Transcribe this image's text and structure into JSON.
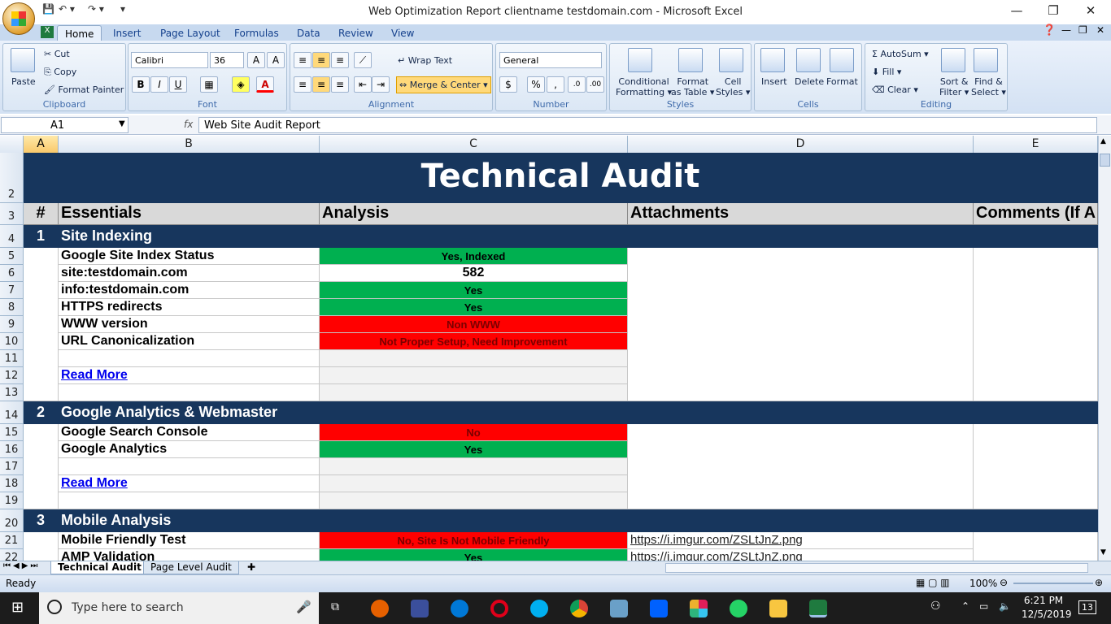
{
  "window": {
    "title": "Web Optimization Report clientname testdomain.com - Microsoft Excel"
  },
  "ribbon_tabs": [
    "Home",
    "Insert",
    "Page Layout",
    "Formulas",
    "Data",
    "Review",
    "View"
  ],
  "ribbon": {
    "clipboard": {
      "paste": "Paste",
      "cut": "Cut",
      "copy": "Copy",
      "format_painter": "Format Painter",
      "group": "Clipboard"
    },
    "font": {
      "name": "Calibri",
      "size": "36",
      "group": "Font"
    },
    "alignment": {
      "wrap": "Wrap Text",
      "merge": "Merge & Center",
      "group": "Alignment"
    },
    "number": {
      "format": "General",
      "group": "Number"
    },
    "styles": {
      "cond_line1": "Conditional",
      "cond_line2": "Formatting",
      "table_line1": "Format",
      "table_line2": "as Table",
      "cell_line1": "Cell",
      "cell_line2": "Styles",
      "group": "Styles"
    },
    "cells": {
      "insert": "Insert",
      "delete": "Delete",
      "format": "Format",
      "group": "Cells"
    },
    "editing": {
      "autosum": "AutoSum",
      "fill": "Fill",
      "clear": "Clear",
      "sort_line1": "Sort &",
      "sort_line2": "Filter",
      "find_line1": "Find &",
      "find_line2": "Select",
      "group": "Editing"
    }
  },
  "formula_bar": {
    "name_box": "A1",
    "fx": "fx",
    "content": "Web Site Audit Report"
  },
  "columns": [
    "A",
    "B",
    "C",
    "D",
    "E"
  ],
  "sheet": {
    "title": "Technical Audit",
    "headers": {
      "num": "#",
      "essentials": "Essentials",
      "analysis": "Analysis",
      "attachments": "Attachments",
      "comments": "Comments (If A"
    },
    "section1": {
      "num": "1",
      "name": "Site Indexing"
    },
    "section2": {
      "num": "2",
      "name": "Google Analytics & Webmaster"
    },
    "section3": {
      "num": "3",
      "name": "Mobile Analysis"
    },
    "r5": {
      "label": "Google Site Index Status",
      "value": "Yes, Indexed"
    },
    "r6": {
      "label": "site:testdomain.com",
      "value": "582"
    },
    "r7": {
      "label": "info:testdomain.com",
      "value": "Yes"
    },
    "r8": {
      "label": "HTTPS redirects",
      "value": "Yes"
    },
    "r9": {
      "label": "WWW version",
      "value": "Non WWW"
    },
    "r10": {
      "label": "URL Canonicalization",
      "value": "Not Proper Setup, Need Improvement"
    },
    "r12": {
      "label": "Read More"
    },
    "r15": {
      "label": "Google Search Console",
      "value": "No"
    },
    "r16": {
      "label": "Google Analytics",
      "value": "Yes"
    },
    "r18": {
      "label": "Read More"
    },
    "r21": {
      "label": "Mobile Friendly Test",
      "value": "No, Site Is Not Mobile Friendly",
      "attachment": "https://i.imgur.com/ZSLtJnZ.png"
    },
    "r22": {
      "label": "AMP Validation",
      "value": "Yes",
      "attachment": "https://i.imgur.com/ZSLtJnZ.png"
    }
  },
  "row_numbers": [
    "2",
    "3",
    "4",
    "5",
    "6",
    "7",
    "8",
    "9",
    "10",
    "11",
    "12",
    "13",
    "14",
    "15",
    "16",
    "17",
    "18",
    "19",
    "20",
    "21",
    "22"
  ],
  "sheet_tabs": [
    "Technical Audit",
    "Page Level Audit"
  ],
  "status": {
    "ready": "Ready",
    "zoom": "100%"
  },
  "taskbar": {
    "search_placeholder": "Type here to search",
    "time": "6:21 PM",
    "date": "12/5/2019",
    "notifications": "13"
  },
  "colors": {
    "navy": "#17365d",
    "green": "#00b050",
    "red": "#ff0000"
  }
}
